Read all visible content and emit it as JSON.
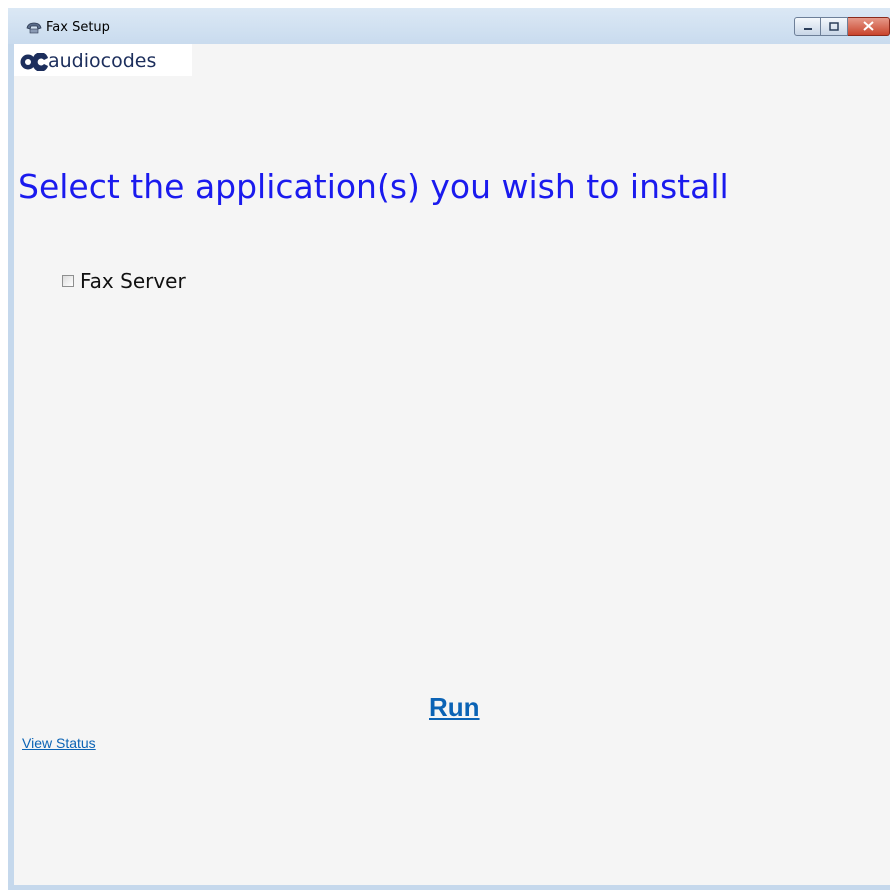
{
  "window": {
    "title": "Fax Setup",
    "icon": "fax-icon",
    "controls": [
      "minimize-icon",
      "maximize-icon",
      "close-icon"
    ]
  },
  "logo": {
    "text": "audiocodes",
    "brand_color": "#1c2e5c"
  },
  "main": {
    "heading": "Select the application(s) you wish to install",
    "heading_color": "#1a1aee",
    "applications": [
      {
        "label": "Fax Server",
        "checked": false
      }
    ],
    "run_label": "Run",
    "view_status_label": "View Status",
    "link_color": "#0b63b5"
  }
}
